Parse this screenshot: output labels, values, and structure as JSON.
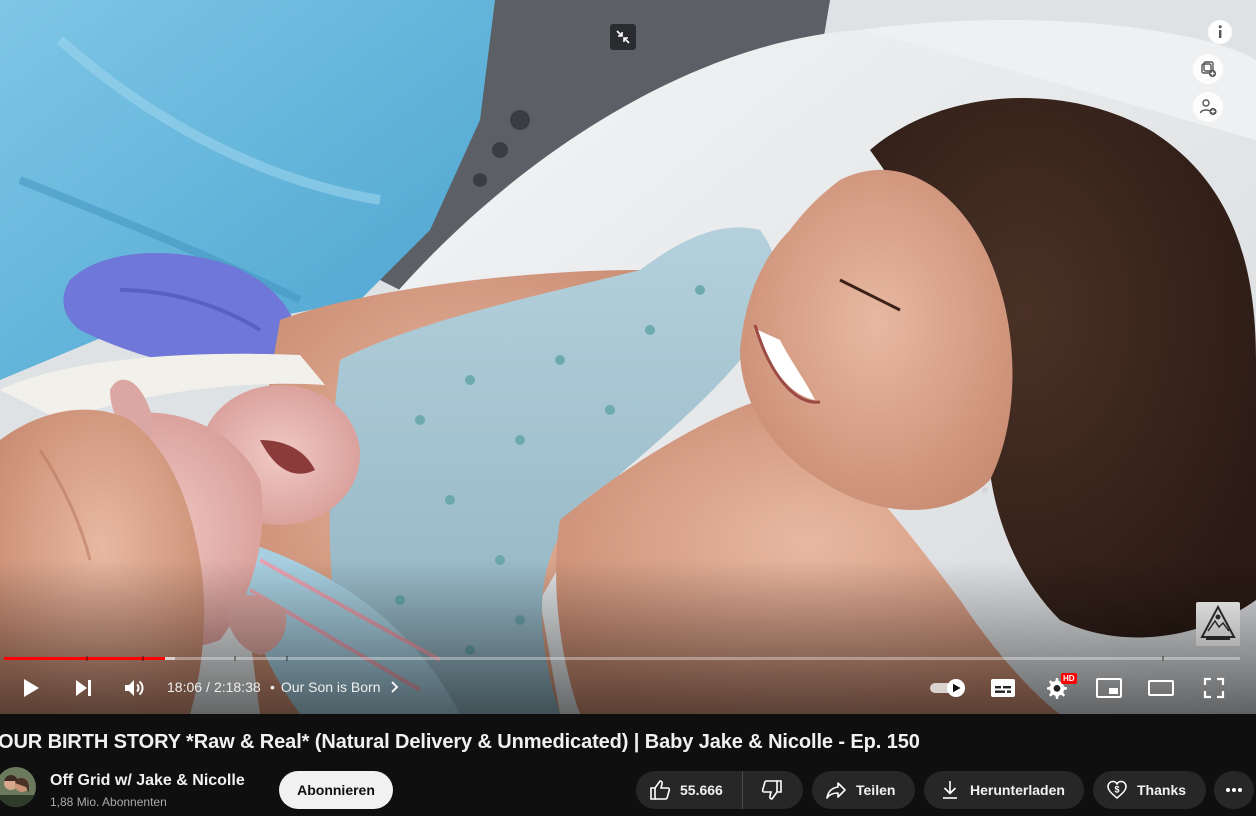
{
  "player": {
    "time_current": "18:06",
    "time_separator": "/",
    "time_total": "2:18:38",
    "chapter_bullet": "•",
    "chapter_title": "Our Son is Born",
    "progress_played": 0.1306,
    "progress_loaded": 0.138,
    "quality_badge": "HD",
    "autoplay_on": true,
    "icons": {
      "top": [
        "info-icon",
        "add-to-playlist-icon",
        "channel-icon",
        "exit-miniplayer-icon"
      ],
      "controls": [
        "play-icon",
        "next-icon",
        "volume-icon",
        "autoplay-toggle-icon",
        "subtitles-icon",
        "settings-icon",
        "miniplayer-icon",
        "theater-mode-icon",
        "fullscreen-icon"
      ]
    }
  },
  "video": {
    "title": "OUR BIRTH STORY *Raw & Real* (Natural Delivery & Unmedicated) | Baby Jake & Nicolle - Ep. 150"
  },
  "channel": {
    "name": "Off Grid w/ Jake & Nicolle",
    "subscribers": "1,88 Mio. Abonnenten",
    "subscribe_label": "Abonnieren"
  },
  "actions": {
    "likes": "55.666",
    "share_label": "Teilen",
    "download_label": "Herunterladen",
    "thanks_label": "Thanks",
    "icons": [
      "like-icon",
      "dislike-icon",
      "share-icon",
      "download-icon",
      "thanks-icon",
      "more-icon"
    ]
  },
  "colors": {
    "accent": "#ff0000",
    "page_background": "#0f0f0f",
    "pill_background": "#272727",
    "subscribe_background": "#f1f1f1"
  }
}
